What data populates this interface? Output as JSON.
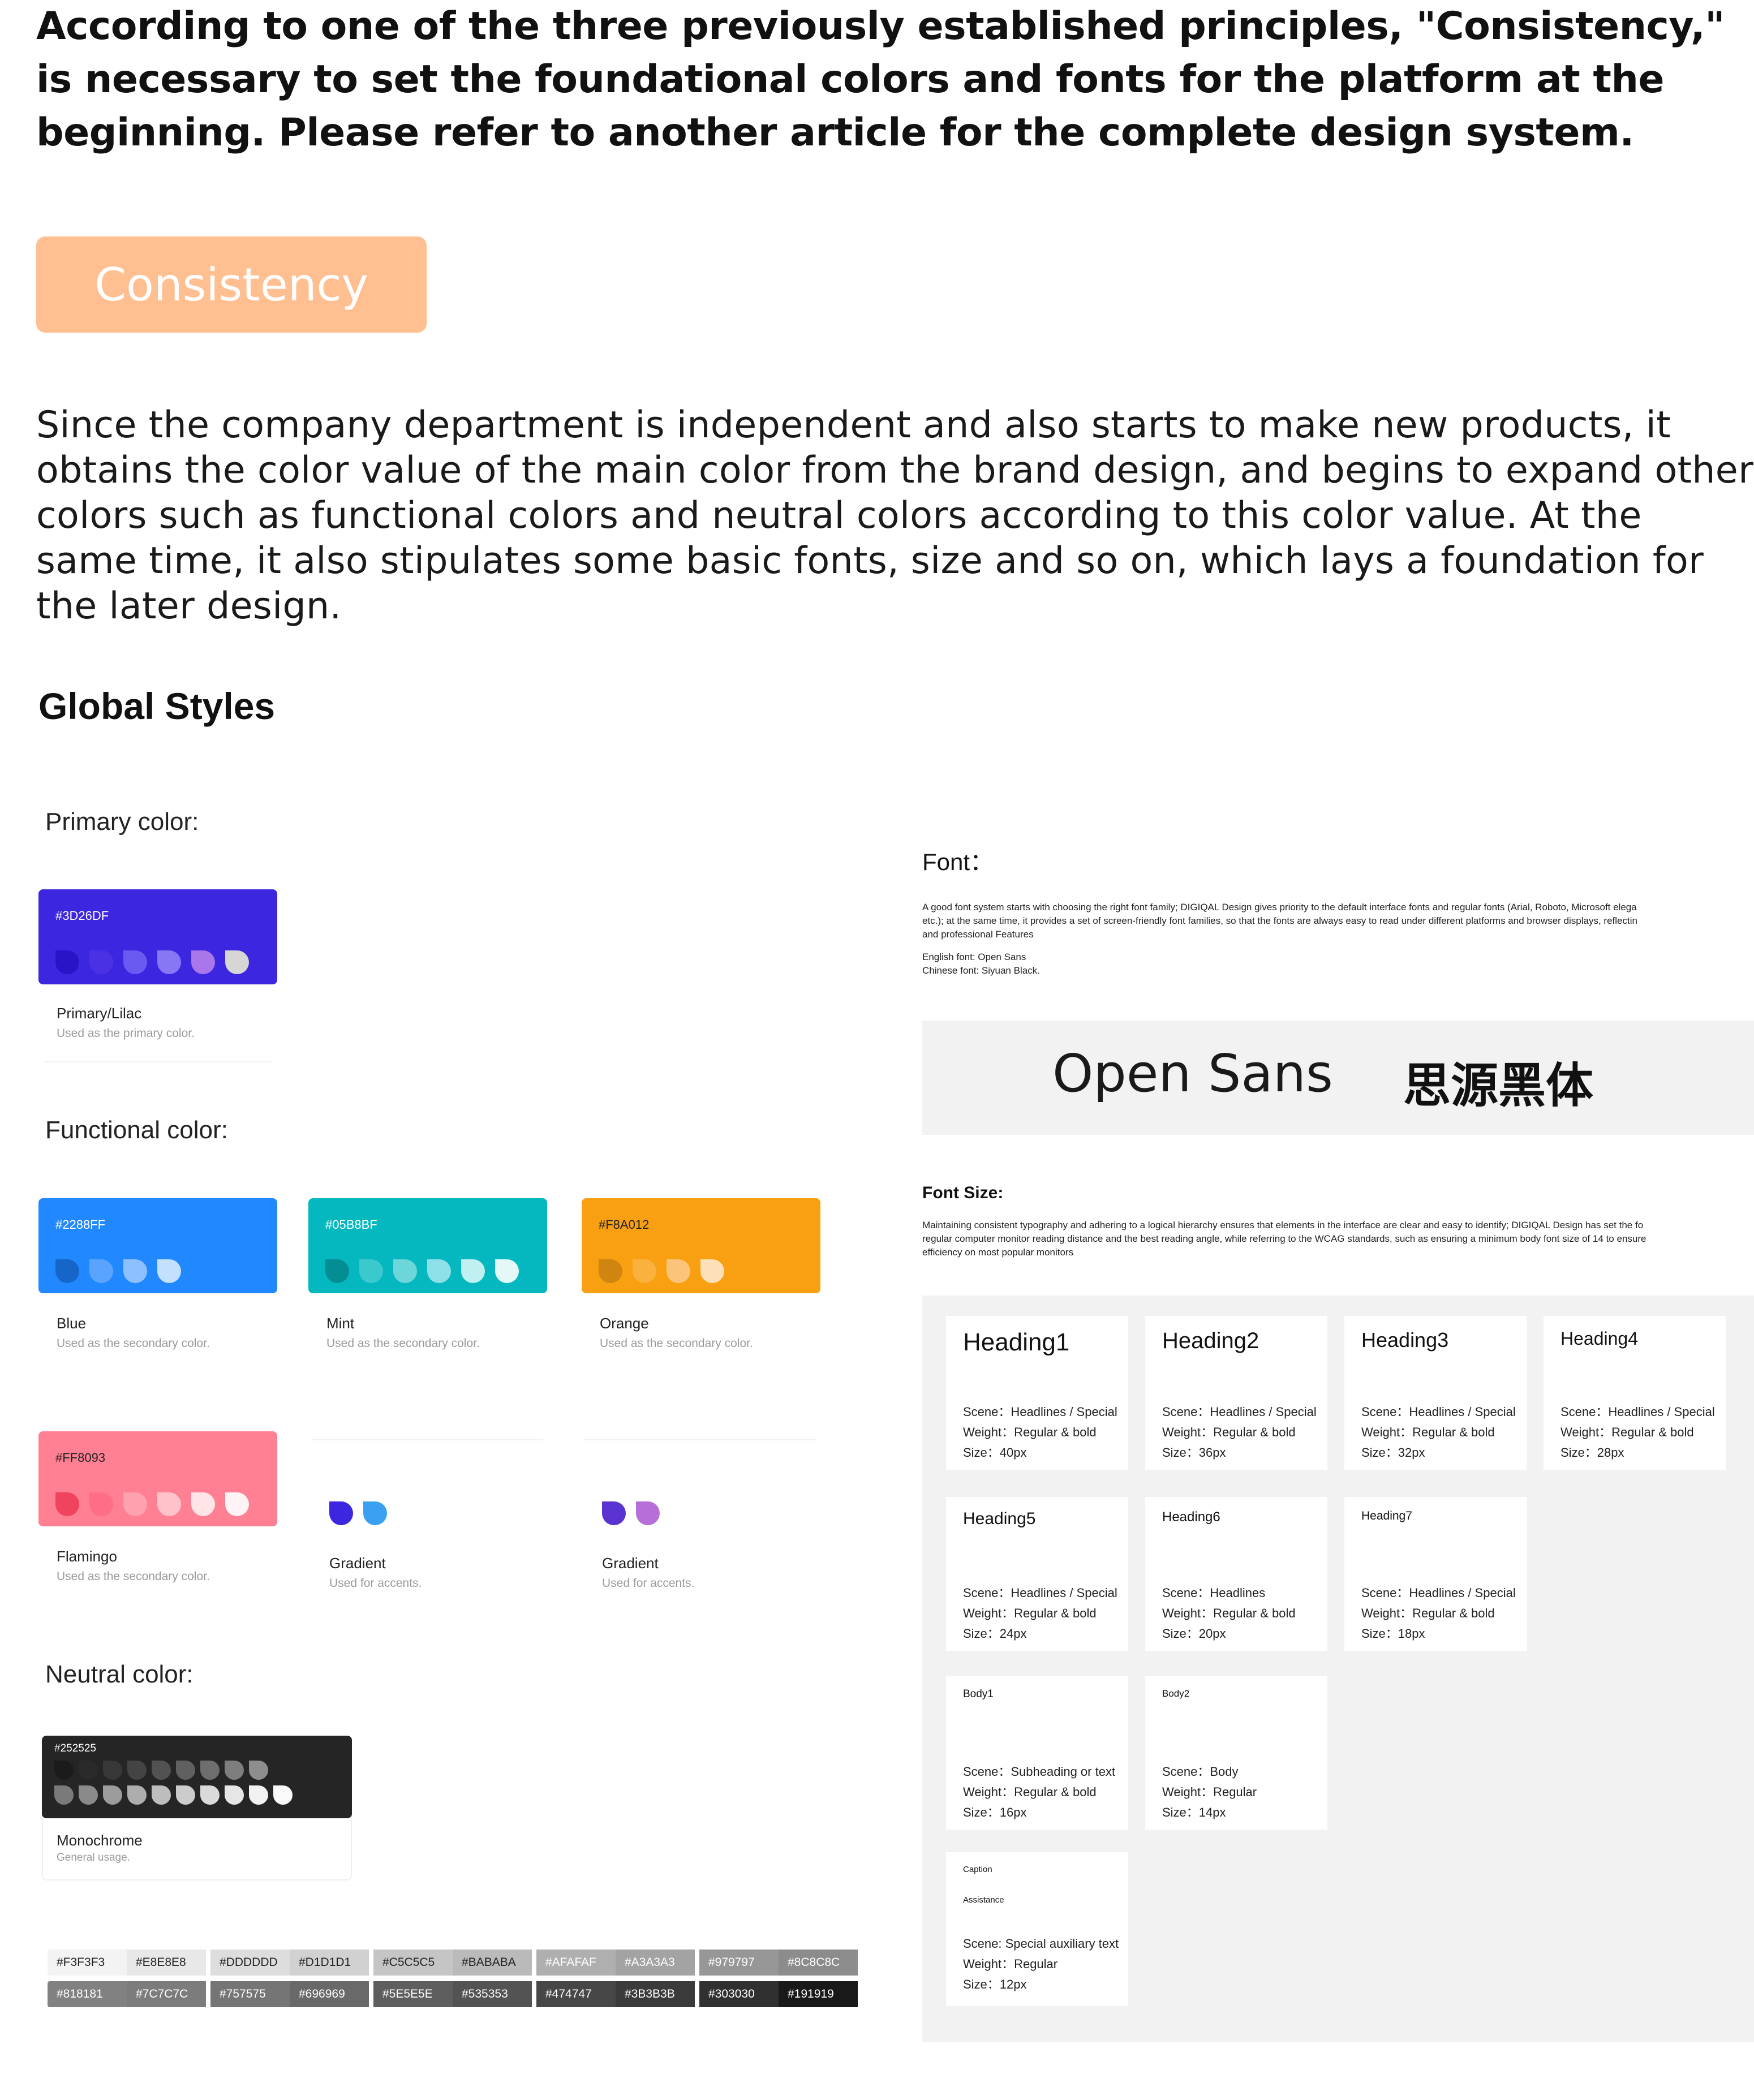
{
  "intro": {
    "lead": "According to one of the three previously established principles, \"Consistency,\" is necessary to set the foundational colors and fonts for the platform at the beginning. Please refer to another article for the complete design system.",
    "button_label": "Consistency",
    "body": "Since the company department is independent and also starts to make new products, it obtains the color value of the main color from the brand design, and begins to expand other colors such as functional colors and neutral colors according to this color value. At the same time, it also stipulates some basic fonts, size and so on, which lays a foundation for the later design."
  },
  "global_title": "Global Styles",
  "primary": {
    "title": "Primary color:",
    "hex": "#3D26DF",
    "bg": "#3d26df",
    "drops": [
      "#2a14c8",
      "#4a32e4",
      "#6b5af0",
      "#8877f5",
      "#a977ea",
      "#d6d6d6"
    ],
    "name": "Primary/Lilac",
    "desc": "Used as the primary color."
  },
  "functional": {
    "title": "Functional color:",
    "cards": [
      {
        "hex": "#2288FF",
        "bg": "#2288ff",
        "text": "#ffffff",
        "drops": [
          "#1566c8",
          "#5aa4ff",
          "#8cc0ff",
          "#c4e0ff"
        ],
        "name": "Blue",
        "desc": "Used as the secondary color."
      },
      {
        "hex": "#05B8BF",
        "bg": "#05b8bf",
        "text": "#ffffff",
        "drops": [
          "#048e93",
          "#3cc9ce",
          "#6cd6da",
          "#8ee0e8",
          "#c1f0f0",
          "#e4f8f8"
        ],
        "name": "Mint",
        "desc": "Used as the secondary color."
      },
      {
        "hex": "#F8A012",
        "bg": "#f8a012",
        "text": "#222222",
        "drops": [
          "#d08510",
          "#fab13d",
          "#fcc47a",
          "#fde0b9"
        ],
        "name": "Orange",
        "desc": "Used as the secondary color."
      },
      {
        "hex": "#FF8093",
        "bg": "#ff8093",
        "text": "#222222",
        "drops": [
          "#f0435e",
          "#ff6e84",
          "#ffa1af",
          "#ffc2cb",
          "#ffe4e8",
          "#fff3f5"
        ],
        "name": "Flamingo",
        "desc": "Used as the secondary color."
      }
    ],
    "gradients": [
      {
        "drops": [
          "#3d26df",
          "#3aa1f0"
        ],
        "name": "Gradient",
        "desc": "Used for accents."
      },
      {
        "drops": [
          "#5a32cf",
          "#b66fd9"
        ],
        "name": "Gradient",
        "desc": "Used for accents."
      }
    ]
  },
  "neutral": {
    "title": "Neutral color:",
    "hex": "#252525",
    "row1": [
      "#1b1b1b",
      "#2a2a2a",
      "#383838",
      "#444444",
      "#525252",
      "#606060",
      "#6e6e6e",
      "#7e7e7e",
      "#8e8e8e"
    ],
    "row2": [
      "#7a7a7a",
      "#8a8a8a",
      "#9c9c9c",
      "#adadad",
      "#bdbdbd",
      "#cccccc",
      "#dadada",
      "#e6e6e6",
      "#f2f2f2",
      "#fafafa"
    ],
    "name": "Monochrome",
    "desc": "General usage."
  },
  "strip": {
    "top": [
      {
        "label": "#F3F3F3",
        "bg": "#f3f3f3",
        "fg": "#222"
      },
      {
        "label": "#E8E8E8",
        "bg": "#e8e8e8",
        "fg": "#222"
      },
      {
        "label": "#DDDDDD",
        "bg": "#dddddd",
        "fg": "#222"
      },
      {
        "label": "#D1D1D1",
        "bg": "#d1d1d1",
        "fg": "#222"
      },
      {
        "label": "#C5C5C5",
        "bg": "#c5c5c5",
        "fg": "#222"
      },
      {
        "label": "#BABABA",
        "bg": "#bababa",
        "fg": "#222"
      },
      {
        "label": "#AFAFAF",
        "bg": "#afafaf",
        "fg": "#fff"
      },
      {
        "label": "#A3A3A3",
        "bg": "#a3a3a3",
        "fg": "#fff"
      },
      {
        "label": "#979797",
        "bg": "#979797",
        "fg": "#fff"
      },
      {
        "label": "#8C8C8C",
        "bg": "#8c8c8c",
        "fg": "#fff"
      }
    ],
    "bottom": [
      {
        "label": "#818181",
        "bg": "#818181",
        "fg": "#fff"
      },
      {
        "label": "#7C7C7C",
        "bg": "#7c7c7c",
        "fg": "#fff"
      },
      {
        "label": "#757575",
        "bg": "#757575",
        "fg": "#fff"
      },
      {
        "label": "#696969",
        "bg": "#696969",
        "fg": "#fff"
      },
      {
        "label": "#5E5E5E",
        "bg": "#5e5e5e",
        "fg": "#fff"
      },
      {
        "label": "#535353",
        "bg": "#535353",
        "fg": "#fff"
      },
      {
        "label": "#474747",
        "bg": "#474747",
        "fg": "#fff"
      },
      {
        "label": "#3B3B3B",
        "bg": "#3b3b3b",
        "fg": "#fff"
      },
      {
        "label": "#303030",
        "bg": "#303030",
        "fg": "#fff"
      },
      {
        "label": "#191919",
        "bg": "#191919",
        "fg": "#fff"
      }
    ]
  },
  "font": {
    "title": "Font：",
    "desc1": "A good font system starts with choosing the right font family; DIGIQAL Design gives priority to the default interface fonts and regular fonts (Arial, Roboto, Microsoft elega",
    "desc2": "etc.); at the same time, it provides a set of screen-friendly font families, so that the fonts are always easy to read under different platforms and browser displays, reflectin",
    "desc3": "and professional Features",
    "english": "English font: Open Sans",
    "chinese": "Chinese font: Siyuan Black.",
    "sample_en": "Open Sans",
    "sample_cn": "思源黑体"
  },
  "font_size": {
    "title": "Font Size:",
    "desc1": "Maintaining consistent typography and adhering to a logical hierarchy ensures that elements in the interface are clear and easy to identify; DIGIQAL Design has set the fo",
    "desc2": "regular computer monitor reading distance and the best reading angle, while referring to the WCAG standards, such as ensuring a minimum body font size of 14 to ensure",
    "desc3": "efficiency on most popular monitors",
    "cards": [
      {
        "title": "Heading1",
        "scene": "Scene：Headlines / Special",
        "weight": "Weight：Regular & bold",
        "size": "Size：40px"
      },
      {
        "title": "Heading2",
        "scene": "Scene：Headlines / Special",
        "weight": "Weight：Regular & bold",
        "size": "Size：36px"
      },
      {
        "title": "Heading3",
        "scene": "Scene：Headlines / Special",
        "weight": "Weight：Regular & bold",
        "size": "Size：32px"
      },
      {
        "title": "Heading4",
        "scene": "Scene：Headlines / Special",
        "weight": "Weight：Regular & bold",
        "size": "Size：28px"
      },
      {
        "title": "Heading5",
        "scene": "Scene：Headlines / Special",
        "weight": "Weight：Regular & bold",
        "size": "Size：24px"
      },
      {
        "title": "Heading6",
        "scene": "Scene：Headlines",
        "weight": "Weight：Regular & bold",
        "size": "Size：20px"
      },
      {
        "title": "Heading7",
        "scene": "Scene：Headlines / Special",
        "weight": "Weight：Regular & bold",
        "size": "Size：18px"
      },
      {
        "title": "Body1",
        "scene": "Scene：Subheading or text",
        "weight": "Weight：Regular & bold",
        "size": "Size：16px"
      },
      {
        "title": "Body2",
        "scene": "Scene：Body",
        "weight": "Weight：Regular",
        "size": "Size：14px"
      },
      {
        "title": "Caption",
        "subtitle": "Assistance",
        "scene": "Scene: Special auxiliary text",
        "weight": "Weight：Regular",
        "size": "Size：12px"
      }
    ]
  }
}
